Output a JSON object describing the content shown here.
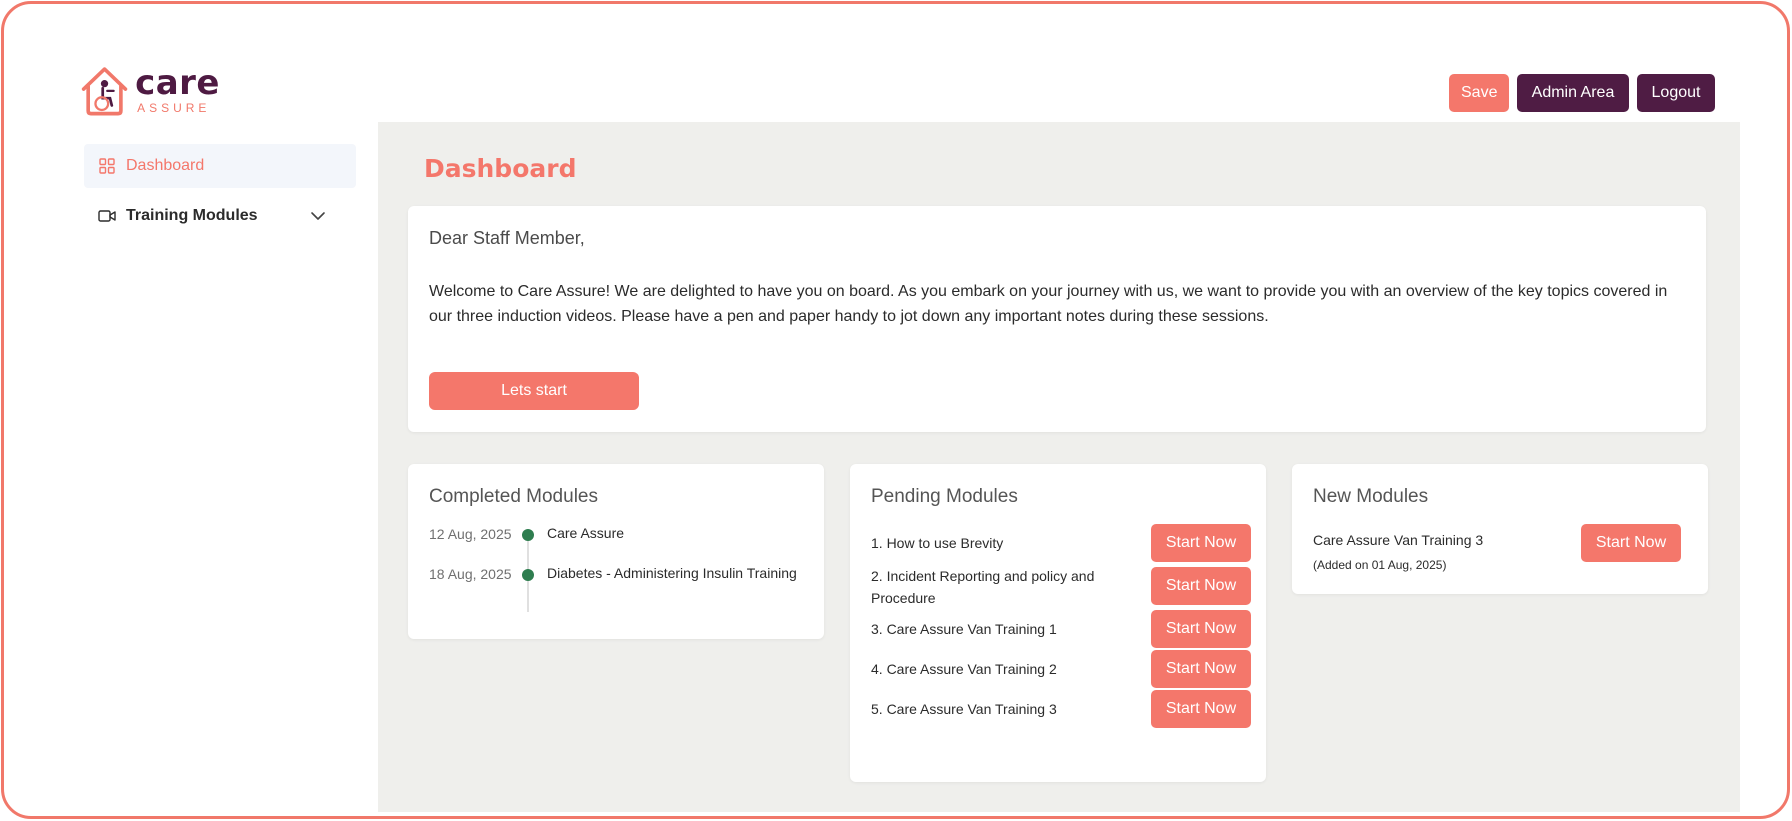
{
  "brand": {
    "name_care": "care",
    "name_assure": "ASSURE",
    "accent": "#f4776b",
    "primary": "#4f1c44"
  },
  "header": {
    "save_label": "Save",
    "admin_label": "Admin Area",
    "logout_label": "Logout"
  },
  "sidebar": {
    "items": [
      {
        "label": "Dashboard",
        "icon": "grid-icon",
        "active": true
      },
      {
        "label": "Training Modules",
        "icon": "video-icon",
        "expandable": true
      }
    ]
  },
  "main": {
    "title": "Dashboard",
    "welcome": {
      "greeting": "Dear Staff Member,",
      "message": "Welcome to Care Assure! We are delighted to have you on board. As you embark on your journey with us, we want to provide you with an overview of the key topics covered in our three induction videos. Please have a pen and paper handy to jot down any important notes during these sessions.",
      "start_label": "Lets start"
    },
    "completed": {
      "title": "Completed Modules",
      "items": [
        {
          "date": "12 Aug, 2025",
          "name": "Care Assure"
        },
        {
          "date": "18 Aug, 2025",
          "name": "Diabetes - Administering Insulin Training"
        }
      ]
    },
    "pending": {
      "title": "Pending Modules",
      "button_label": "Start Now",
      "items": [
        "1. How to use Brevity",
        "2. Incident Reporting and policy and Procedure",
        "3. Care Assure Van Training 1",
        "4. Care Assure Van Training 2",
        "5. Care Assure Van Training 3"
      ]
    },
    "new_modules": {
      "title": "New Modules",
      "items": [
        {
          "name": "Care Assure Van Training 3",
          "added": "(Added on 01 Aug, 2025)",
          "button_label": "Start Now"
        }
      ]
    }
  }
}
